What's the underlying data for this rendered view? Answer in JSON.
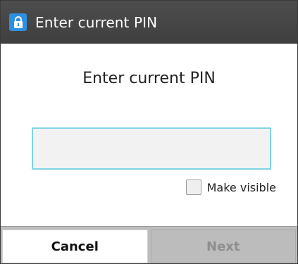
{
  "titlebar": {
    "title": "Enter current PIN",
    "icon": "lock-icon",
    "accent": "#2f8fe0"
  },
  "dialog": {
    "heading": "Enter current PIN",
    "pin_value": "",
    "make_visible_label": "Make visible",
    "make_visible_checked": false
  },
  "buttons": {
    "cancel": "Cancel",
    "next": "Next"
  }
}
